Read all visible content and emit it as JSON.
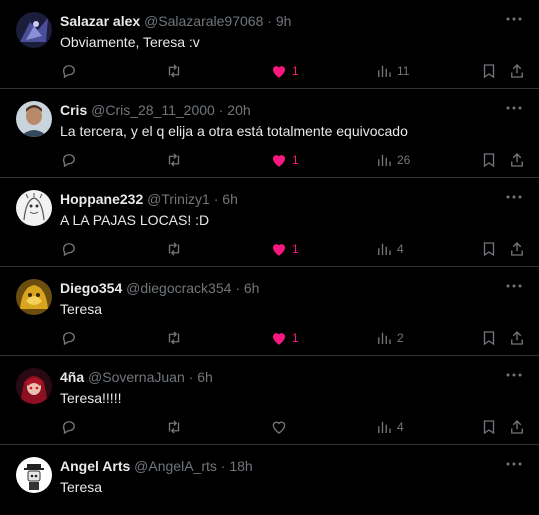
{
  "tweets": [
    {
      "name": "Salazar alex",
      "handle": "@Salazarale97068",
      "sep": "·",
      "time": "9h",
      "text": "Obviamente, Teresa :v",
      "likes": "1",
      "liked": true,
      "views": "11",
      "avatar": "avatar-dark-figure"
    },
    {
      "name": "Cris",
      "handle": "@Cris_28_11_2000",
      "sep": "·",
      "time": "20h",
      "text": "La tercera, y el q elija a otra está totalmente equivocado",
      "likes": "1",
      "liked": true,
      "views": "26",
      "avatar": "avatar-man-photo"
    },
    {
      "name": "Hoppane232",
      "handle": "@Trinizy1",
      "sep": "·",
      "time": "6h",
      "text": "A LA PAJAS LOCAS! :D",
      "likes": "1",
      "liked": true,
      "views": "4",
      "avatar": "avatar-sketch"
    },
    {
      "name": "Diego354",
      "handle": "@diegocrack354",
      "sep": "·",
      "time": "6h",
      "text": "Teresa",
      "likes": "1",
      "liked": true,
      "views": "2",
      "avatar": "avatar-gold-creature"
    },
    {
      "name": "4ña",
      "handle": "@SovernaJuan",
      "sep": "·",
      "time": "6h",
      "text": "Teresa!!!!!",
      "likes": "",
      "liked": false,
      "views": "4",
      "avatar": "avatar-red-anime"
    },
    {
      "name": "Angel Arts",
      "handle": "@AngelA_rts",
      "sep": "·",
      "time": "18h",
      "text": "Teresa",
      "avatar": "avatar-cartoon-hat"
    }
  ],
  "colors": {
    "background": "#000000",
    "text": "#e7e9ea",
    "muted": "#71767b",
    "like": "#f91880",
    "divider": "#2f3336"
  }
}
